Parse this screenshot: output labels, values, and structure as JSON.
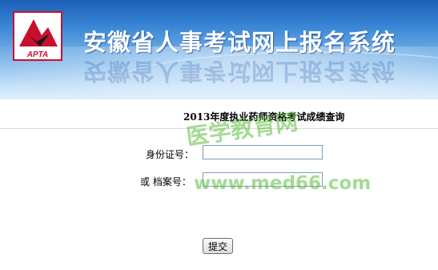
{
  "header": {
    "logo_text": "APTA",
    "logo_icon": "apta-logo-icon",
    "system_title": "安徽省人事考试网上报名系统"
  },
  "form": {
    "title": "2013年度执业药师资格考试成绩查询",
    "id_label": "身份证号：",
    "id_value": "",
    "archive_label": "或  档案号：",
    "archive_value": "",
    "submit_label": "提交"
  },
  "watermark": {
    "chinese": "医学教育网",
    "url": "www.med66.com"
  },
  "colors": {
    "header_dark": "#1a5fb8",
    "header_light": "#dbeefc",
    "watermark": "#5abe3c"
  }
}
